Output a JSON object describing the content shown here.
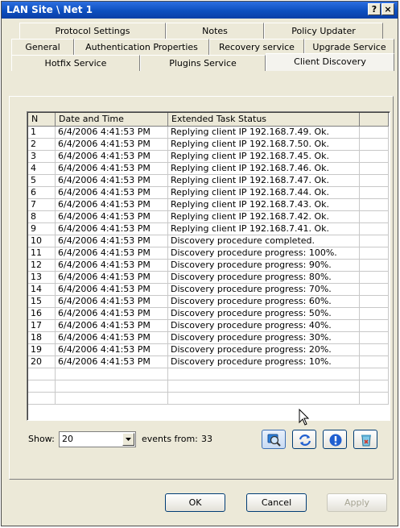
{
  "window": {
    "title": "LAN Site \\ Net 1",
    "help_glyph": "?",
    "close_glyph": "×"
  },
  "tabs": {
    "row1": [
      "Protocol Settings",
      "Notes",
      "Policy Updater"
    ],
    "row2": [
      "General",
      "Authentication Properties",
      "Recovery service",
      "Upgrade Service"
    ],
    "row3": [
      "Hotfix Service",
      "Plugins Service",
      "Client Discovery"
    ],
    "active": "Client Discovery"
  },
  "table": {
    "columns": [
      "N",
      "Date and Time",
      "Extended Task Status"
    ],
    "rows": [
      [
        "1",
        "6/4/2006 4:41:53 PM",
        "Replying client IP 192.168.7.49. Ok."
      ],
      [
        "2",
        "6/4/2006 4:41:53 PM",
        "Replying client IP 192.168.7.50. Ok."
      ],
      [
        "3",
        "6/4/2006 4:41:53 PM",
        "Replying client IP 192.168.7.45. Ok."
      ],
      [
        "4",
        "6/4/2006 4:41:53 PM",
        "Replying client IP 192.168.7.46. Ok."
      ],
      [
        "5",
        "6/4/2006 4:41:53 PM",
        "Replying client IP 192.168.7.47. Ok."
      ],
      [
        "6",
        "6/4/2006 4:41:53 PM",
        "Replying client IP 192.168.7.44. Ok."
      ],
      [
        "7",
        "6/4/2006 4:41:53 PM",
        "Replying client IP 192.168.7.43. Ok."
      ],
      [
        "8",
        "6/4/2006 4:41:53 PM",
        "Replying client IP 192.168.7.42. Ok."
      ],
      [
        "9",
        "6/4/2006 4:41:53 PM",
        "Replying client IP 192.168.7.41. Ok."
      ],
      [
        "10",
        "6/4/2006 4:41:53 PM",
        "Discovery procedure completed."
      ],
      [
        "11",
        "6/4/2006 4:41:53 PM",
        "Discovery procedure progress: 100%."
      ],
      [
        "12",
        "6/4/2006 4:41:53 PM",
        "Discovery procedure progress: 90%."
      ],
      [
        "13",
        "6/4/2006 4:41:53 PM",
        "Discovery procedure progress: 80%."
      ],
      [
        "14",
        "6/4/2006 4:41:53 PM",
        "Discovery procedure progress: 70%."
      ],
      [
        "15",
        "6/4/2006 4:41:53 PM",
        "Discovery procedure progress: 60%."
      ],
      [
        "16",
        "6/4/2006 4:41:53 PM",
        "Discovery procedure progress: 50%."
      ],
      [
        "17",
        "6/4/2006 4:41:53 PM",
        "Discovery procedure progress: 40%."
      ],
      [
        "18",
        "6/4/2006 4:41:53 PM",
        "Discovery procedure progress: 30%."
      ],
      [
        "19",
        "6/4/2006 4:41:53 PM",
        "Discovery procedure progress: 20%."
      ],
      [
        "20",
        "6/4/2006 4:41:53 PM",
        "Discovery procedure progress: 10%."
      ]
    ],
    "empty_rows": 3
  },
  "controls": {
    "show_label": "Show:",
    "show_value": "20",
    "events_from_label": "events from:",
    "events_from_value": "33",
    "icon_buttons": [
      "search-icon",
      "refresh-icon",
      "info-icon",
      "clear-log-icon"
    ]
  },
  "dialog_buttons": {
    "ok": "OK",
    "cancel": "Cancel",
    "apply": "Apply"
  },
  "colors": {
    "titlebar": "#0d4fbf",
    "face": "#ece9d8",
    "info_blue": "#1f5fd0"
  }
}
